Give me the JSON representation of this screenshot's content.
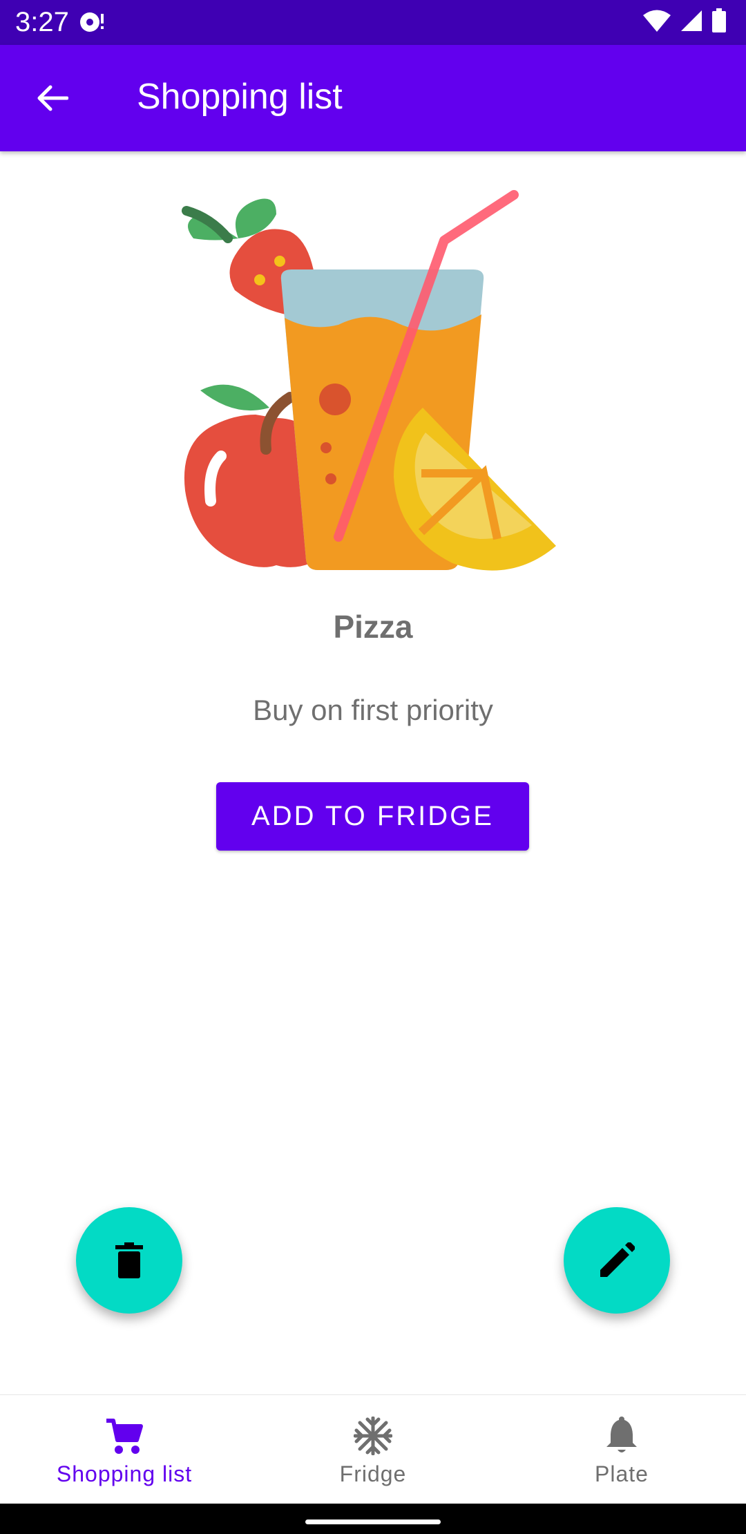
{
  "status_bar": {
    "time": "3:27",
    "icons": [
      "notification-icon",
      "wifi-icon",
      "signal-icon",
      "battery-icon"
    ]
  },
  "app_bar": {
    "title": "Shopping list",
    "back_icon": "arrow-back-icon",
    "color": "#6200ee"
  },
  "item": {
    "illustration": "juice-and-fruit-illustration",
    "name": "Pizza",
    "note": "Buy on first priority",
    "action_label": "ADD TO FRIDGE"
  },
  "fabs": {
    "delete_icon": "trash-icon",
    "edit_icon": "pencil-icon",
    "color": "#03dac5"
  },
  "bottom_nav": {
    "items": [
      {
        "label": "Shopping list",
        "icon": "cart-icon",
        "active": true
      },
      {
        "label": "Fridge",
        "icon": "snowflake-icon",
        "active": false
      },
      {
        "label": "Plate",
        "icon": "bell-icon",
        "active": false
      }
    ],
    "active_color": "#6200ee",
    "inactive_color": "#6f6f6f"
  }
}
